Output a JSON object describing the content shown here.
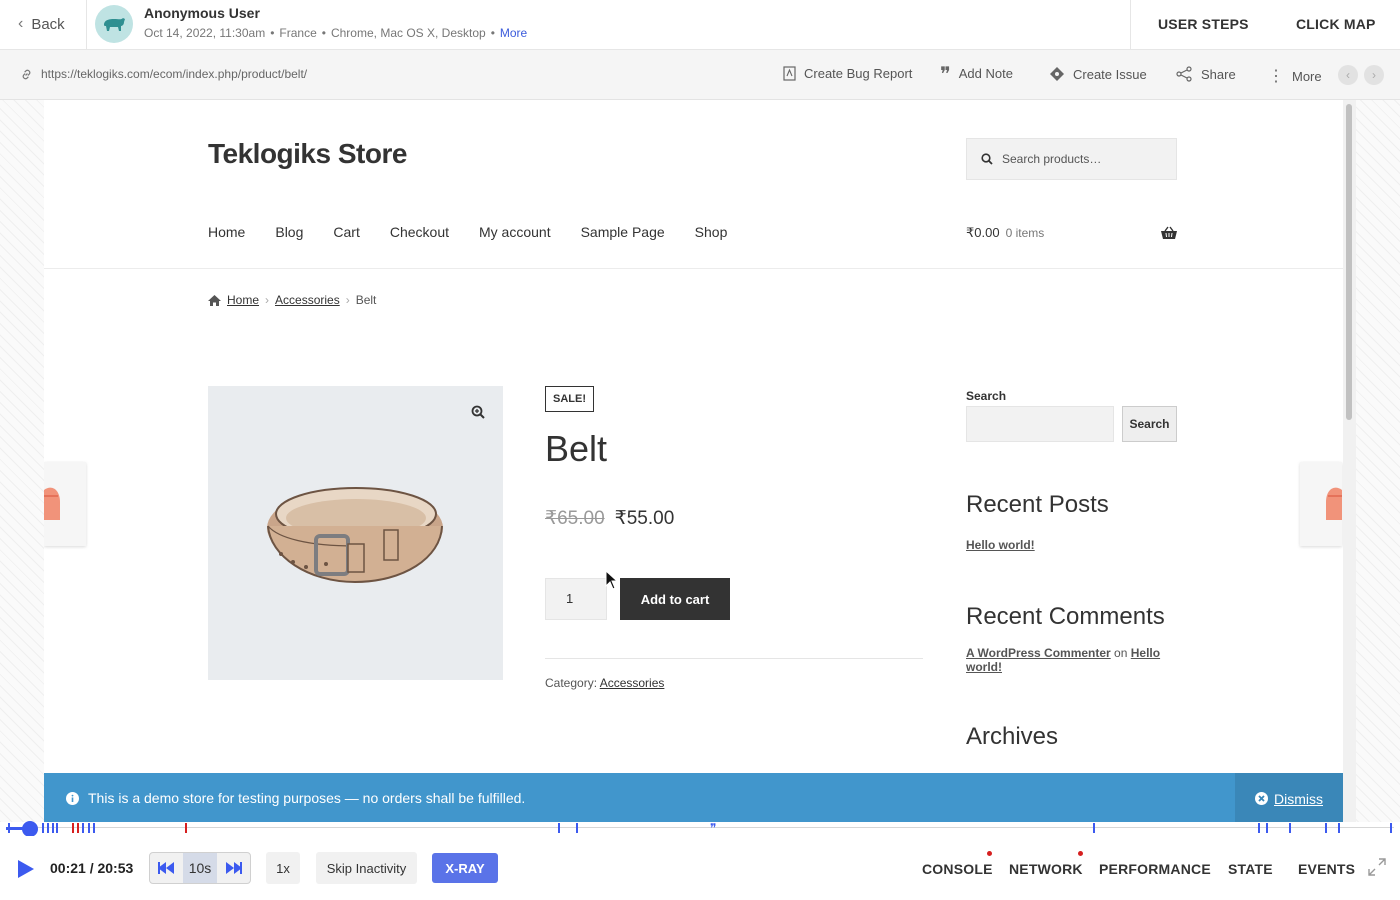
{
  "header": {
    "back_label": "Back",
    "user_name": "Anonymous User",
    "user_meta": {
      "datetime": "Oct 14, 2022, 11:30am",
      "country": "France",
      "env": "Chrome, Mac OS X, Desktop",
      "more": "More"
    },
    "tabs": [
      "USER STEPS",
      "CLICK MAP"
    ]
  },
  "toolbar": {
    "url": "https://teklogiks.com/ecom/index.php/product/belt/",
    "actions": [
      "Create Bug Report",
      "Add Note",
      "Create Issue",
      "Share",
      "More"
    ]
  },
  "site": {
    "title": "Teklogiks Store",
    "search_placeholder": "Search products…",
    "menu": [
      "Home",
      "Blog",
      "Cart",
      "Checkout",
      "My account",
      "Sample Page",
      "Shop"
    ],
    "cart_total": "₹0.00",
    "cart_items": "0 items",
    "breadcrumb": [
      "Home",
      "Accessories",
      "Belt"
    ],
    "product": {
      "badge": "SALE!",
      "title": "Belt",
      "old_price": "₹65.00",
      "price": "₹55.00",
      "quantity": "1",
      "add_to_cart": "Add to cart",
      "category_label": "Category:",
      "category": "Accessories"
    },
    "sidebar": {
      "search_label": "Search",
      "search_button": "Search",
      "recent_posts_title": "Recent Posts",
      "recent_post": "Hello world!",
      "recent_comments_title": "Recent Comments",
      "comment_author": "A WordPress Commenter",
      "comment_on": "on",
      "comment_post": "Hello world!",
      "archives_title": "Archives"
    },
    "notice": {
      "message": "This is a demo store for testing purposes — no orders shall be fulfilled.",
      "dismiss": "Dismiss"
    }
  },
  "player": {
    "time": "00:21 / 20:53",
    "skip_label": "10s",
    "speed": "1x",
    "skip_inactivity": "Skip Inactivity",
    "xray": "X-RAY",
    "progress": 0.017,
    "tabs": [
      "CONSOLE",
      "NETWORK",
      "PERFORMANCE",
      "STATE",
      "EVENTS"
    ]
  },
  "colors": {
    "accent": "#3c5aef",
    "notice_bg": "#4196cc",
    "error_dot": "#d61f1f"
  }
}
